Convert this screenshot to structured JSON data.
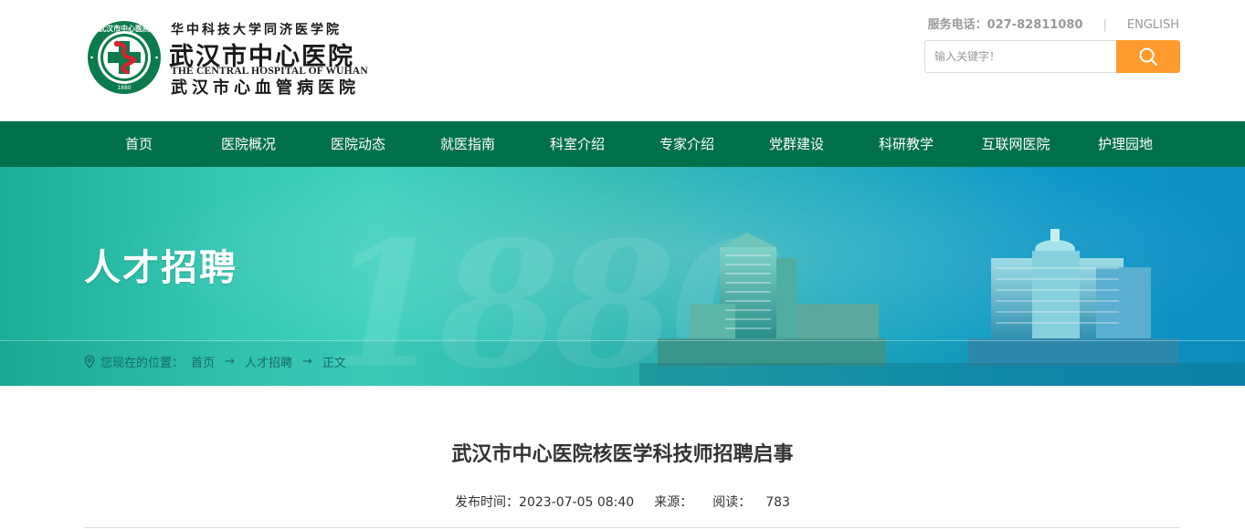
{
  "header": {
    "logo": {
      "line1": "华中科技大学同济医学院",
      "line2": "武汉市中心医院",
      "line3": "THE CENTRAL HOSPITAL OF WUHAN",
      "line4": "武汉市心血管病医院",
      "emblem_ring_text": "武汉市中心医院",
      "emblem_year": "1880"
    },
    "phone": "服务电话：027-82811080",
    "separator": "|",
    "english_link": "ENGLISH",
    "search": {
      "placeholder": "输入关键字！"
    }
  },
  "nav": {
    "items": [
      "首页",
      "医院概况",
      "医院动态",
      "就医指南",
      "科室介绍",
      "专家介绍",
      "党群建设",
      "科研教学",
      "互联网医院",
      "护理园地"
    ]
  },
  "banner": {
    "title": "人才招聘",
    "watermark": "1880",
    "breadcrumb": {
      "prefix": "您现在的位置：",
      "items": [
        "首页",
        "人才招聘",
        "正文"
      ],
      "arrow": "→"
    }
  },
  "article": {
    "title": "武汉市中心医院核医学科技师招聘启事",
    "publish_label": "发布时间：",
    "publish_time": "2023-07-05 08:40",
    "source_label": "来源：",
    "source_value": "",
    "read_label": "阅读：",
    "read_count": "783"
  },
  "colors": {
    "nav_bg": "#00704a",
    "search_btn": "#fe9a2e",
    "logo_green": "#0b7a4c",
    "logo_red": "#d9232e"
  }
}
